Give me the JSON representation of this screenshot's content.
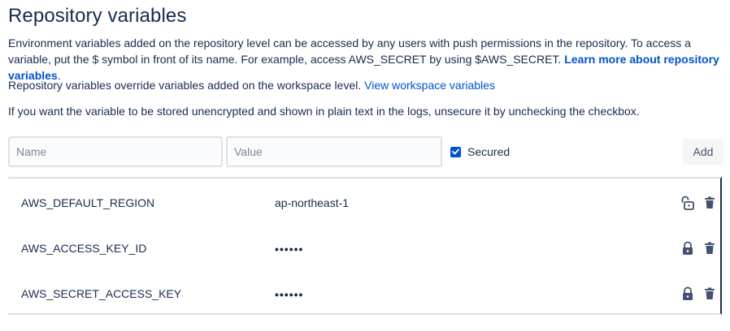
{
  "title": "Repository variables",
  "description": {
    "text": "Environment variables added on the repository level can be accessed by any users with push permissions in the repository. To access a variable, put the $ symbol in front of its name. For example, access AWS_SECRET by using $AWS_SECRET. ",
    "link": "Learn more about repository variables",
    "end": "."
  },
  "override": {
    "text": "Repository variables override variables added on the workspace level. ",
    "link": "View workspace variables"
  },
  "unsecure_note": "If you want the variable to be stored unencrypted and shown in plain text in the logs, unsecure it by unchecking the checkbox.",
  "form": {
    "name_placeholder": "Name",
    "value_placeholder": "Value",
    "secured_label": "Secured",
    "secured_checked": true,
    "add_label": "Add"
  },
  "variables": [
    {
      "key": "AWS_DEFAULT_REGION",
      "value": "ap-northeast-1",
      "secured": false,
      "lock_icon": "unlock-icon",
      "delete_icon": "trash-icon"
    },
    {
      "key": "AWS_ACCESS_KEY_ID",
      "value": "••••••",
      "secured": true,
      "lock_icon": "lock-icon",
      "delete_icon": "trash-icon"
    },
    {
      "key": "AWS_SECRET_ACCESS_KEY",
      "value": "••••••",
      "secured": true,
      "lock_icon": "lock-icon",
      "delete_icon": "trash-icon"
    }
  ],
  "colors": {
    "text": "#172b4d",
    "link": "#0052cc",
    "checkbox": "#0052cc",
    "icon": "#42526e"
  }
}
